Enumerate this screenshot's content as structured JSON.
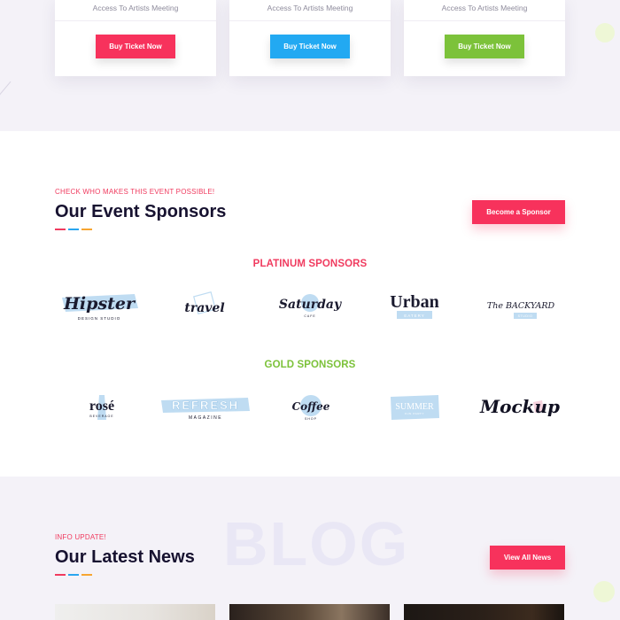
{
  "colors": {
    "pink": "#f7325c",
    "blue": "#22a9f2",
    "green": "#7cc23a",
    "dash_pink": "#f03b5f",
    "dash_blue": "#2aa6ef",
    "dash_orange": "#f7a531",
    "navy": "#171230"
  },
  "pricing": {
    "cards": [
      {
        "feature": "Access To Artists Meeting",
        "button": "Buy Ticket Now",
        "color": "#f7325c"
      },
      {
        "feature": "Access To Artists Meeting",
        "button": "Buy Ticket Now",
        "color": "#22a9f2"
      },
      {
        "feature": "Access To Artists Meeting",
        "button": "Buy Ticket Now",
        "color": "#7cc23a"
      }
    ]
  },
  "sponsors": {
    "eyebrow": "CHECK WHO MAKES THIS EVENT POSSIBLE!",
    "title_plain": "Our Event ",
    "title_highlight": "Sponsors",
    "cta": "Become a Sponsor",
    "platinum": {
      "title": "PLATINUM SPONSORS",
      "logos": [
        {
          "name": "Hipster",
          "tagline": "DESIGN STUDIO",
          "icon": "hipster-logo"
        },
        {
          "name": "travel",
          "tagline": "",
          "icon": "travel-logo"
        },
        {
          "name": "Saturday",
          "tagline": "CAFE",
          "icon": "saturday-logo"
        },
        {
          "name": "Urban",
          "tagline": "EATERY",
          "icon": "urban-logo"
        },
        {
          "name": "The BACKYARD",
          "tagline": "STUDIO",
          "icon": "backyard-logo"
        }
      ]
    },
    "gold": {
      "title": "GOLD SPONSORS",
      "logos": [
        {
          "name": "rosé",
          "tagline": "BEVERAGE",
          "icon": "rose-logo"
        },
        {
          "name": "REFRESH",
          "tagline": "MAGAZINE",
          "icon": "refresh-logo"
        },
        {
          "name": "Coffee",
          "tagline": "SHOP",
          "icon": "coffee-logo"
        },
        {
          "name": "SUMMER",
          "tagline": "FUN PARTY",
          "icon": "summer-logo"
        },
        {
          "name": "Mockup",
          "tagline": "",
          "icon": "mockup-logo"
        }
      ]
    }
  },
  "blog": {
    "ghost": "BLOG",
    "eyebrow": "INFO UPDATE!",
    "title_plain": "Our Latest ",
    "title_highlight": "News",
    "cta": "View All News"
  }
}
